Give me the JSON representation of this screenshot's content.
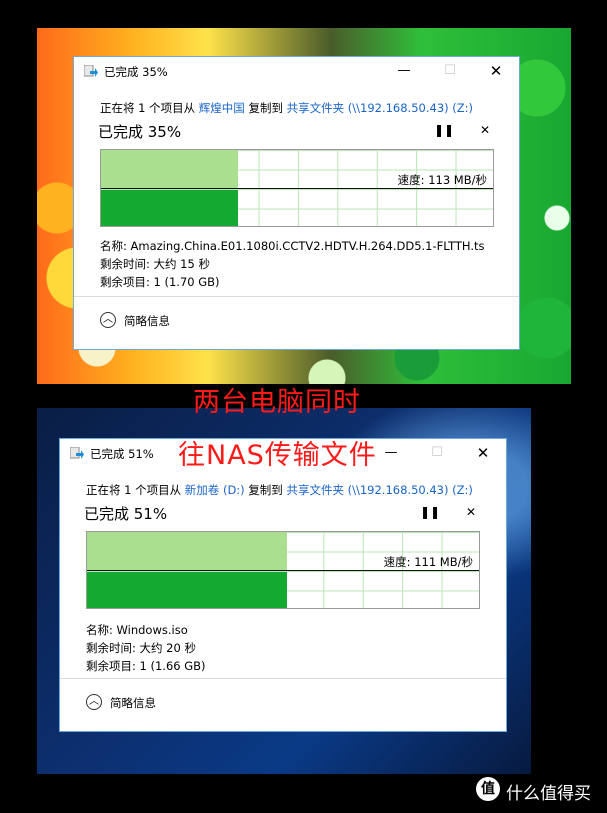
{
  "dialogs": [
    {
      "title": "已完成 35%",
      "line": {
        "prefix": "正在将 1 个项目从 ",
        "source": "辉煌中国",
        "middle": " 复制到 ",
        "dest": "共享文件夹 (\\\\192.168.50.43) (Z:)"
      },
      "heading": "已完成 35%",
      "progress_fraction": 0.35,
      "speed": "速度: 113 MB/秒",
      "name": "名称:  Amazing.China.E01.1080i.CCTV2.HDTV.H.264.DD5.1-FLTTH.ts",
      "time_remaining": "剩余时间: 大约 15 秒",
      "items_remaining": "剩余项目: 1 (1.70 GB)",
      "toggle_label": "简略信息"
    },
    {
      "title": "已完成 51%",
      "line": {
        "prefix": "正在将 1 个项目从 ",
        "source": "新加卷 (D:)",
        "middle": " 复制到 ",
        "dest": "共享文件夹 (\\\\192.168.50.43) (Z:)"
      },
      "heading": "已完成 51%",
      "progress_fraction": 0.51,
      "speed": "速度: 111 MB/秒",
      "name": "名称:  Windows.iso",
      "time_remaining": "剩余时间: 大约 20 秒",
      "items_remaining": "剩余项目: 1 (1.66 GB)",
      "toggle_label": "简略信息"
    }
  ],
  "window_controls": {
    "minimize": "—",
    "maximize": "☐",
    "close": "✕",
    "pause": "❚❚",
    "cancel": "✕",
    "chevron": "︿"
  },
  "overlay": {
    "line1": "两台电脑同时",
    "line2": "往NAS传输文件"
  },
  "watermark": {
    "logo": "值",
    "text": "什么值得买"
  },
  "colors": {
    "overlay": "#ff1a1a",
    "link": "#1a64c8",
    "progress_dark": "#14aa31",
    "progress_light": "#a9df8e"
  }
}
